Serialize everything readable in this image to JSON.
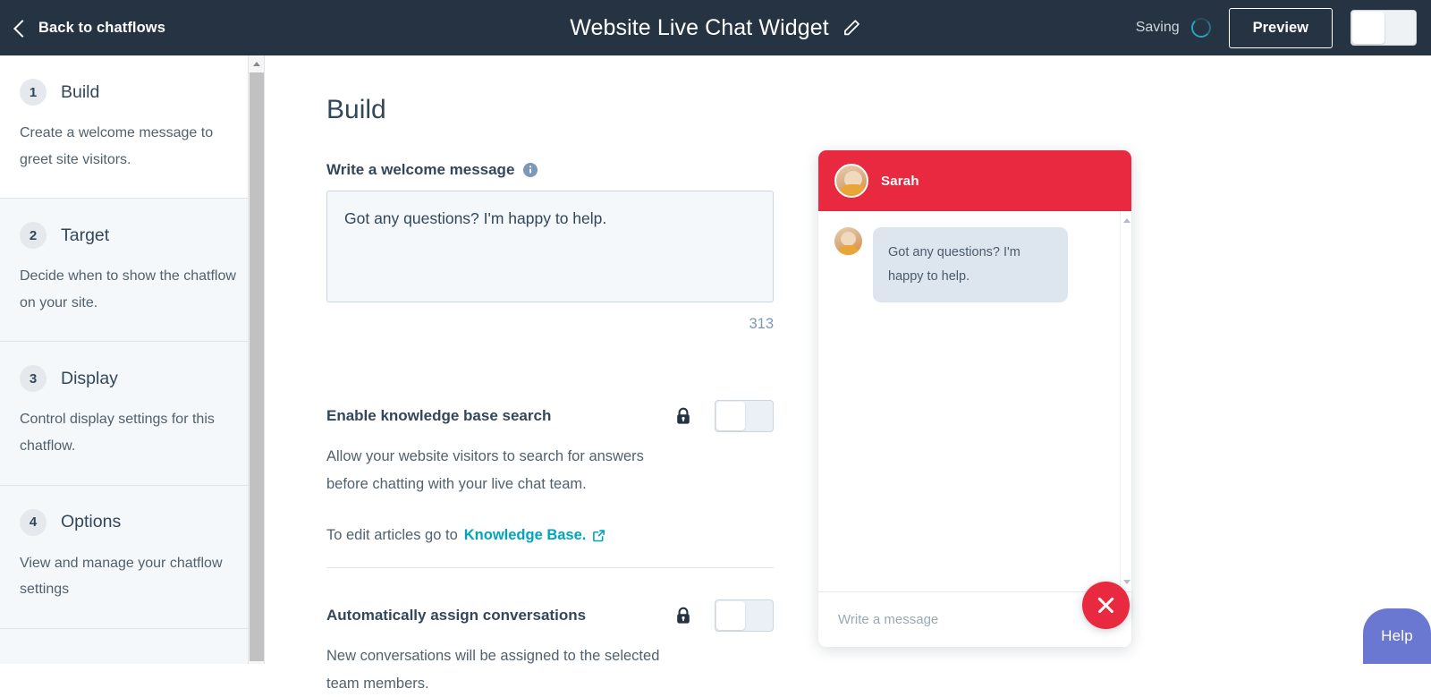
{
  "header": {
    "back_label": "Back to chatflows",
    "back_icon": "chevron-left-icon",
    "title": "Website Live Chat Widget",
    "edit_icon": "pencil-icon",
    "saving_label": "Saving",
    "spinner_icon": "loading-spinner-icon",
    "preview_label": "Preview",
    "publish_toggle_state": "off",
    "bg_color": "#253342"
  },
  "sidebar": {
    "steps": [
      {
        "number": "1",
        "title": "Build",
        "desc": "Create a welcome message to greet site visitors.",
        "active": true
      },
      {
        "number": "2",
        "title": "Target",
        "desc": "Decide when to show the chatflow on your site.",
        "active": false
      },
      {
        "number": "3",
        "title": "Display",
        "desc": "Control display settings for this chatflow.",
        "active": false
      },
      {
        "number": "4",
        "title": "Options",
        "desc": "View and manage your chatflow settings",
        "active": false
      }
    ],
    "scrollbar": {
      "up_arrow_icon": "scroll-up-arrow-icon"
    }
  },
  "main": {
    "page_title": "Build",
    "welcome": {
      "label": "Write a welcome message",
      "info_icon": "info-icon",
      "value": "Got any questions? I'm happy to help.",
      "char_count": "313"
    },
    "settings": [
      {
        "name": "Enable knowledge base search",
        "desc": "Allow your website visitors to search for answers before chatting with your live chat team.",
        "lock_icon": "lock-icon",
        "toggle_state": "off",
        "footnote_prefix": "To edit articles go to ",
        "footnote_link": "Knowledge Base.",
        "external_icon": "external-link-icon"
      },
      {
        "name": "Automatically assign conversations",
        "desc": "New conversations will be assigned to the selected team members.",
        "lock_icon": "lock-icon",
        "toggle_state": "off"
      }
    ]
  },
  "chat_preview": {
    "agent_name": "Sarah",
    "avatar_icon": "agent-avatar",
    "header_color": "#E8293F",
    "message": "Got any questions? I'm happy to help.",
    "input_placeholder": "Write a message",
    "send_icon": "send-paper-plane-icon",
    "scroll_up_icon": "scroll-up-arrow-icon",
    "scroll_down_icon": "scroll-down-arrow-icon",
    "close_icon": "close-x-icon"
  },
  "help": {
    "label": "Help",
    "color": "#6A78D1"
  }
}
